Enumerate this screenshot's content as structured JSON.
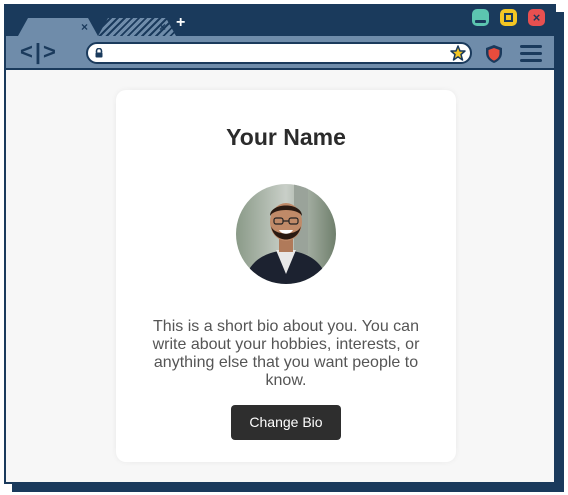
{
  "browser": {
    "tabs": [
      {
        "close_glyph": "×",
        "state": "active"
      },
      {
        "close_glyph": "×",
        "state": "inactive"
      }
    ],
    "new_tab_glyph": "+",
    "window_buttons": {
      "minimize_icon": "minimize-icon",
      "maximize_icon": "maximize-icon",
      "close_glyph": "×"
    },
    "toolbar": {
      "nav_glyph": "<|>",
      "address_value": "",
      "icons": [
        "lock-icon",
        "star-icon",
        "shield-icon",
        "hamburger-menu-icon"
      ]
    },
    "colors": {
      "frame": "#1a3a5c",
      "toolbar": "#6f8caa",
      "minimize": "#5cc5b0",
      "maximize": "#f3c623",
      "close": "#e85050",
      "shield": "#e84c3d",
      "star": "#f3c623"
    }
  },
  "profile": {
    "name": "Your Name",
    "avatar_icon": "profile-photo",
    "bio": "This is a short bio about you. You can write about your hobbies, interests, or anything else that you want people to know.",
    "button_label": "Change Bio",
    "colors": {
      "button": "#2e2e2e",
      "card": "#ffffff",
      "page": "#f7f7f7"
    }
  }
}
